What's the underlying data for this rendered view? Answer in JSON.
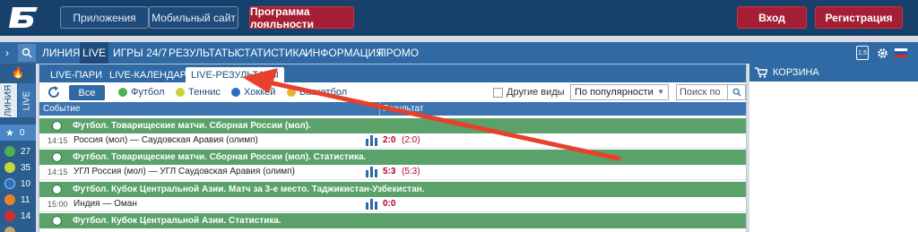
{
  "header": {
    "apps_label": "Приложения",
    "mobile_label": "Мобильный сайт",
    "loyalty_label": "Программа лояльности",
    "login_label": "Вход",
    "register_label": "Регистрация"
  },
  "nav": {
    "items": [
      "ЛИНИЯ",
      "LIVE",
      "ИГРЫ 24/7",
      "РЕЗУЛЬТАТЫ",
      "СТАТИСТИКА",
      "ИНФОРМАЦИЯ",
      "ПРОМО"
    ],
    "active": "LIVE",
    "badge": "1.5"
  },
  "sidebar": {
    "tab_line": "ЛИНИЯ",
    "tab_live": "LIVE",
    "rows": [
      {
        "icon": "star-icon",
        "count": "0",
        "color": "#4a86c3"
      },
      {
        "icon": "football-icon",
        "count": "27",
        "color": "#4caf50"
      },
      {
        "icon": "tennis-icon",
        "count": "35",
        "color": "#c6d53a"
      },
      {
        "icon": "hockey-icon",
        "count": "10",
        "color": "#2a6fc0"
      },
      {
        "icon": "basketball-icon",
        "count": "11",
        "color": "#e8832c"
      },
      {
        "icon": "table-tennis-icon",
        "count": "14",
        "color": "#d0302f"
      }
    ]
  },
  "tabs": {
    "pairs": "LIVE-ПАРИ",
    "calendar": "LIVE-КАЛЕНДАРЬ",
    "results": "LIVE-РЕЗУЛЬТАТЫ"
  },
  "filters": {
    "all": "Все",
    "sports": [
      {
        "label": "Футбол",
        "color": "#4caf50"
      },
      {
        "label": "Теннис",
        "color": "#c6d53a"
      },
      {
        "label": "Хоккей",
        "color": "#2a6fc0"
      },
      {
        "label": "Баскетбол",
        "color": "#e8b32c"
      }
    ],
    "other": "Другие виды",
    "sort": "По популярности",
    "search_placeholder": "Поиск по"
  },
  "columns": {
    "event": "Событие",
    "result": "Результат"
  },
  "groups": [
    {
      "title": "Футбол. Товарищеские матчи. Сборная России (мол)."
    },
    {
      "title": "Футбол. Товарищеские матчи. Сборная России (мол). Статистика."
    },
    {
      "title": "Футбол. Кубок Центральной Азии. Матч за 3-е место. Таджикистан-Узбекистан."
    },
    {
      "title": "Футбол. Кубок Центральной Азии. Статистика."
    }
  ],
  "events": [
    {
      "time": "14:15",
      "name": "Россия (мол) — Саудовская Аравия (олимп)",
      "score": "2:0",
      "sub": "(2:0)"
    },
    {
      "time": "14:15",
      "name": "УГЛ Россия (мол) — УГЛ Саудовская Аравия (олимп)",
      "score": "5:3",
      "sub": "(5:3)"
    },
    {
      "time": "15:00",
      "name": "Индия — Оман",
      "score": "0:0",
      "sub": ""
    }
  ],
  "cart": {
    "title": "КОРЗИНА"
  },
  "colors": {
    "header": "#17406b",
    "nav": "#2f6aa4",
    "group": "#5aa16a",
    "score": "#b3002d",
    "accent_red": "#a41e34",
    "annotation_arrow": "#e8402a"
  }
}
